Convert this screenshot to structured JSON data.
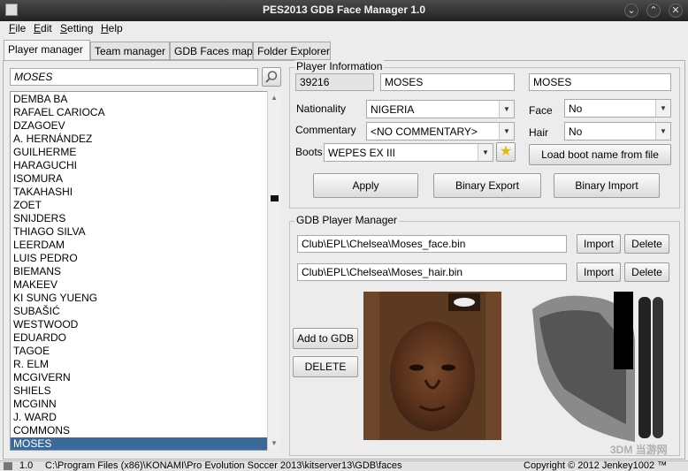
{
  "window": {
    "title": "PES2013 GDB Face Manager 1.0"
  },
  "menu": [
    "File",
    "Edit",
    "Setting",
    "Help"
  ],
  "tabs": [
    "Player manager",
    "Team manager",
    "GDB Faces map",
    "Folder Explorer"
  ],
  "search": {
    "value": "MOSES"
  },
  "players": [
    "DEMBA BA",
    "RAFAEL CARIOCA",
    "DZAGOEV",
    "A. HERNÁNDEZ",
    "GUILHERME",
    "HARAGUCHI",
    "ISOMURA",
    "TAKAHASHI",
    "ZOET",
    "SNIJDERS",
    "THIAGO SILVA",
    "LEERDAM",
    "LUIS PEDRO",
    "BIEMANS",
    "MAKEEV",
    "KI SUNG YUENG",
    "SUBAŠIĆ",
    "WESTWOOD",
    "EDUARDO",
    "TAGOE",
    "R. ELM",
    "MCGIVERN",
    "SHIELS",
    "MCGINN",
    "J. WARD",
    "COMMONS",
    "MOSES"
  ],
  "selected_player": "MOSES",
  "player_info": {
    "group_title": "Player Information",
    "id": "39216",
    "name": "MOSES",
    "shirt_name": "MOSES",
    "nationality_label": "Nationality",
    "nationality_value": "NIGERIA",
    "commentary_label": "Commentary",
    "commentary_value": "<NO COMMENTARY>",
    "boots_label": "Boots",
    "boots_value": "WEPES EX III",
    "face_label": "Face",
    "face_value": "No",
    "hair_label": "Hair",
    "hair_value": "No",
    "load_boot_label": "Load boot name from file",
    "apply_label": "Apply",
    "binary_export_label": "Binary Export",
    "binary_import_label": "Binary Import"
  },
  "gdb_manager": {
    "group_title": "GDB Player Manager",
    "face_path": "Club\\EPL\\Chelsea\\Moses_face.bin",
    "hair_path": "Club\\EPL\\Chelsea\\Moses_hair.bin",
    "import_label": "Import",
    "delete_label": "Delete",
    "add_label": "Add to GDB",
    "delete_big_label": "DELETE"
  },
  "status": {
    "version": "1.0",
    "path": "C:\\Program Files (x86)\\KONAMI\\Pro Evolution Soccer 2013\\kitserver13\\GDB\\faces",
    "copyright": "Copyright © 2012 Jenkey1002 ™"
  },
  "watermark": "3DM 当游网",
  "colors": {
    "selection": "#3b6a9a",
    "titlebar": "#2a2a2a"
  }
}
